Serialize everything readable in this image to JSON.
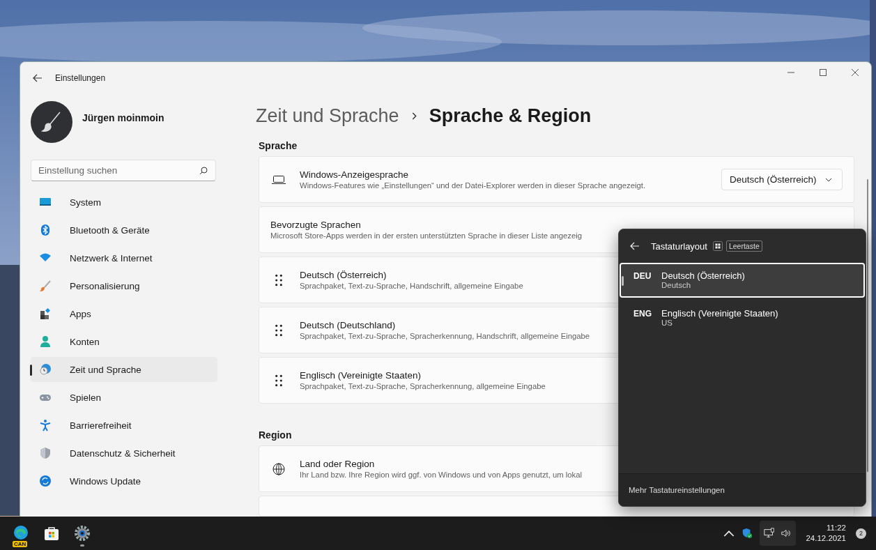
{
  "window": {
    "title": "Einstellungen"
  },
  "user": {
    "name": "Jürgen moinmoin"
  },
  "search": {
    "placeholder": "Einstellung suchen"
  },
  "nav": [
    {
      "label": "System",
      "kind": "system",
      "selected": false
    },
    {
      "label": "Bluetooth & Geräte",
      "kind": "bluetooth",
      "selected": false
    },
    {
      "label": "Netzwerk & Internet",
      "kind": "wifi",
      "selected": false
    },
    {
      "label": "Personalisierung",
      "kind": "brush",
      "selected": false
    },
    {
      "label": "Apps",
      "kind": "apps",
      "selected": false
    },
    {
      "label": "Konten",
      "kind": "person",
      "selected": false
    },
    {
      "label": "Zeit und Sprache",
      "kind": "clock",
      "selected": true
    },
    {
      "label": "Spielen",
      "kind": "gamepad",
      "selected": false
    },
    {
      "label": "Barrierefreiheit",
      "kind": "access",
      "selected": false
    },
    {
      "label": "Datenschutz & Sicherheit",
      "kind": "shield",
      "selected": false
    },
    {
      "label": "Windows Update",
      "kind": "update",
      "selected": false
    }
  ],
  "breadcrumb": {
    "parent": "Zeit und Sprache",
    "current": "Sprache & Region"
  },
  "sections": [
    {
      "title": "Sprache",
      "cards": [
        {
          "kind": "dropdown",
          "title": "Windows-Anzeigesprache",
          "description": "Windows-Features wie „Einstellungen“ und der Datei-Explorer werden in dieser Sprache angezeigt.",
          "value": "Deutsch (Österreich)"
        },
        {
          "kind": "plain",
          "title": "Bevorzugte Sprachen",
          "description": "Microsoft Store-Apps werden in der ersten unterstützten Sprache in dieser Liste angezeig"
        },
        {
          "kind": "language",
          "title": "Deutsch (Österreich)",
          "description": "Sprachpaket, Text-zu-Sprache, Handschrift, allgemeine Eingabe"
        },
        {
          "kind": "language",
          "title": "Deutsch (Deutschland)",
          "description": "Sprachpaket, Text-zu-Sprache, Spracherkennung, Handschrift, allgemeine Eingabe"
        },
        {
          "kind": "language",
          "title": "Englisch (Vereinigte Staaten)",
          "description": "Sprachpaket, Text-zu-Sprache, Spracherkennung, allgemeine Eingabe"
        }
      ]
    },
    {
      "title": "Region",
      "cards": [
        {
          "kind": "region",
          "title": "Land oder Region",
          "description": "Ihr Land bzw. Ihre Region wird ggf. von Windows und von Apps genutzt, um lokal"
        },
        {
          "kind": "partial"
        }
      ]
    }
  ],
  "flyout": {
    "title": "Tastaturlayout",
    "shortcut": "Leertaste",
    "layouts": [
      {
        "code": "DEU",
        "name": "Deutsch (Österreich)",
        "sub": "Deutsch",
        "selected": true
      },
      {
        "code": "ENG",
        "name": "Englisch (Vereinigte Staaten)",
        "sub": "US",
        "selected": false
      }
    ],
    "footer": "Mehr Tastatureinstellungen"
  },
  "taskbar": {
    "apps": [
      {
        "kind": "edge",
        "badge": "CAN"
      },
      {
        "kind": "store"
      },
      {
        "kind": "settings"
      }
    ],
    "time": "11:22",
    "date": "24.12.2021",
    "notifications": "2"
  }
}
